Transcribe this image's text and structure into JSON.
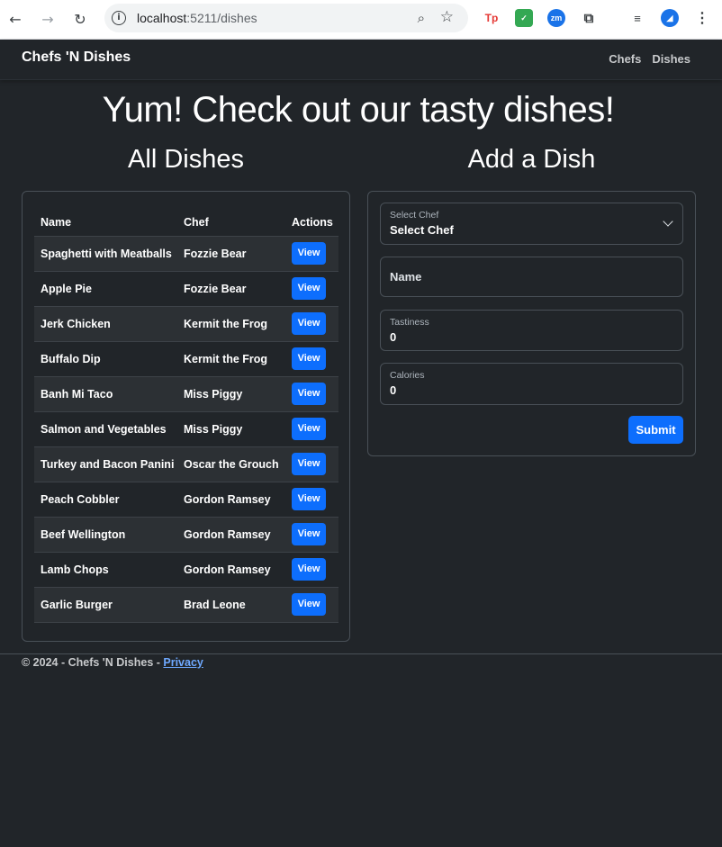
{
  "browser": {
    "url_host": "localhost",
    "url_path": ":5211/dishes"
  },
  "navbar": {
    "brand": "Chefs 'N Dishes",
    "links": [
      "Chefs",
      "Dishes"
    ]
  },
  "hero_title": "Yum! Check out our tasty dishes!",
  "dishes_section": {
    "title": "All Dishes",
    "columns": [
      "Name",
      "Chef",
      "Actions"
    ],
    "view_label": "View",
    "rows": [
      {
        "name": "Spaghetti with Meatballs",
        "chef": "Fozzie Bear"
      },
      {
        "name": "Apple Pie",
        "chef": "Fozzie Bear"
      },
      {
        "name": "Jerk Chicken",
        "chef": "Kermit the Frog"
      },
      {
        "name": "Buffalo Dip",
        "chef": "Kermit the Frog"
      },
      {
        "name": "Banh Mi Taco",
        "chef": "Miss Piggy"
      },
      {
        "name": "Salmon and Vegetables",
        "chef": "Miss Piggy"
      },
      {
        "name": "Turkey and Bacon Panini",
        "chef": "Oscar the Grouch"
      },
      {
        "name": "Peach Cobbler",
        "chef": "Gordon Ramsey"
      },
      {
        "name": "Beef Wellington",
        "chef": "Gordon Ramsey"
      },
      {
        "name": "Lamb Chops",
        "chef": "Gordon Ramsey"
      },
      {
        "name": "Garlic Burger",
        "chef": "Brad Leone"
      }
    ]
  },
  "form_section": {
    "title": "Add a Dish",
    "chef_select": {
      "label": "Select Chef",
      "value": "Select Chef"
    },
    "name_field": {
      "placeholder": "Name"
    },
    "tastiness_field": {
      "label": "Tastiness",
      "value": "0"
    },
    "calories_field": {
      "label": "Calories",
      "value": "0"
    },
    "submit_label": "Submit"
  },
  "footer": {
    "text": "© 2024 - Chefs 'N Dishes - ",
    "privacy_link": "Privacy"
  },
  "colors": {
    "background": "#212529",
    "primary": "#0d6efd",
    "link": "#6ea8fe"
  }
}
